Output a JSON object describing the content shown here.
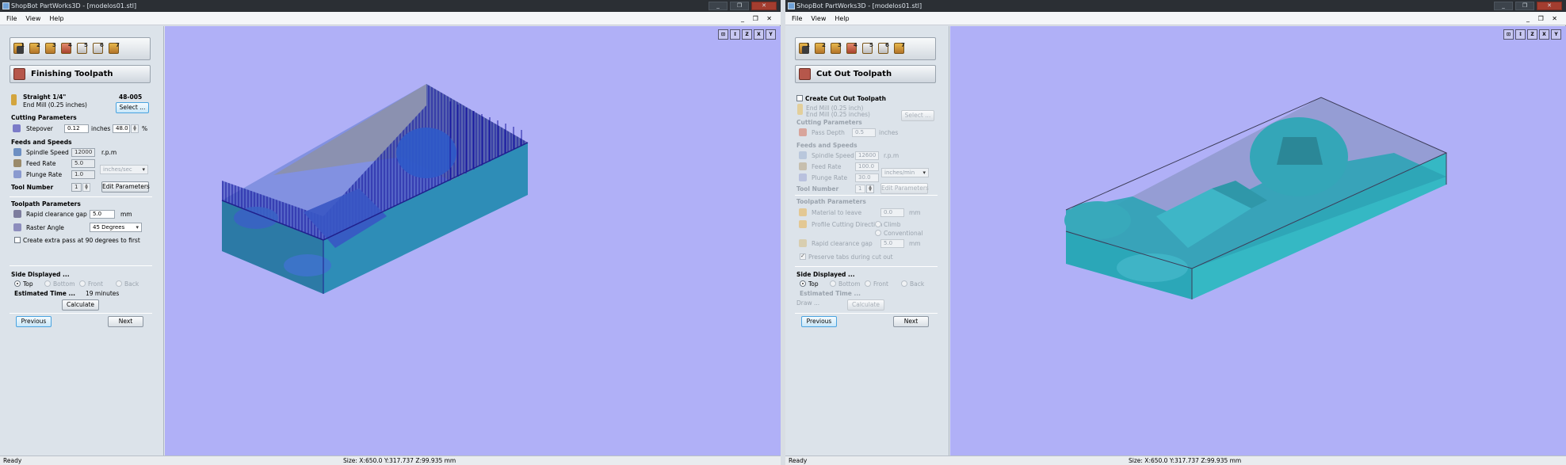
{
  "left": {
    "title": "ShopBot PartWorks3D - [modelos01.stl]",
    "window_controls": [
      "_",
      "❐",
      "✕"
    ],
    "menu": [
      "File",
      "View",
      "Help"
    ],
    "mdi_controls": "_ ❐ ✕",
    "toolbar": [
      "1",
      "2",
      "3",
      "4",
      "5",
      "6",
      "7"
    ],
    "page_title": "Finishing Toolpath",
    "tool_name": "Straight 1/4\"",
    "tool_desc": "End Mill (0.25 inches)",
    "tool_code": "48-005",
    "select_button": "Select ...",
    "cutting_header": "Cutting Parameters",
    "stepover_label": "Stepover",
    "stepover_value": "0.12",
    "stepover_unit": "inches",
    "stepover_pct": "48.0",
    "pct_sign": "%",
    "feeds_header": "Feeds and Speeds",
    "spindle_label": "Spindle Speed",
    "spindle_value": "12000",
    "spindle_unit": "r.p.m",
    "feed_label": "Feed Rate",
    "feed_value": "5.0",
    "rate_units": "inches/sec",
    "plunge_label": "Plunge Rate",
    "plunge_value": "1.0",
    "toolnum_label": "Tool Number",
    "toolnum_value": "1",
    "edit_params": "Edit Parameters",
    "toolpath_header": "Toolpath Parameters",
    "rapid_label": "Rapid clearance gap",
    "rapid_value": "5.0",
    "rapid_unit": "mm",
    "raster_label": "Raster Angle",
    "raster_value": "45 Degrees",
    "extra_pass_label": "Create extra pass at 90 degrees to first",
    "side_header": "Side Displayed ...",
    "side_options": [
      "Top",
      "Bottom",
      "Front",
      "Back"
    ],
    "est_label": "Estimated Time ...",
    "est_value": "19 minutes",
    "calculate": "Calculate",
    "previous": "Previous",
    "next": "Next",
    "view_tools": [
      "⊡",
      "↕",
      "Z",
      "X",
      "Y"
    ],
    "status_left": "Ready",
    "status_center": "Size: X:650.0 Y:317.737 Z:99.935 mm"
  },
  "right": {
    "title": "ShopBot PartWorks3D - [modelos01.stl]",
    "window_controls": [
      "_",
      "❐",
      "✕"
    ],
    "menu": [
      "File",
      "View",
      "Help"
    ],
    "mdi_controls": "_ ❐ ✕",
    "toolbar": [
      "1",
      "2",
      "3",
      "4",
      "5",
      "6",
      "7"
    ],
    "page_title": "Cut Out Toolpath",
    "create_label": "Create Cut Out Toolpath",
    "tool_desc": "End Mill (0.25 inch)",
    "tool_desc2": "End Mill (0.25 inches)",
    "select_button": "Select ...",
    "cutting_header": "Cutting Parameters",
    "pass_depth_label": "Pass Depth",
    "pass_depth_value": "0.5",
    "pass_depth_unit": "inches",
    "feeds_header": "Feeds and Speeds",
    "spindle_label": "Spindle Speed",
    "spindle_value": "12600",
    "spindle_unit": "r.p.m",
    "feed_label": "Feed Rate",
    "feed_value": "100.0",
    "rate_units": "inches/min",
    "plunge_label": "Plunge Rate",
    "plunge_value": "30.0",
    "toolnum_label": "Tool Number",
    "toolnum_value": "1",
    "edit_params": "Edit Parameters",
    "toolpath_header": "Toolpath Parameters",
    "material_label": "Material to leave",
    "material_value": "0.0",
    "material_unit": "mm",
    "direction_label": "Profile Cutting Direction",
    "direction_options": [
      "Climb",
      "Conventional"
    ],
    "rapid_label": "Rapid clearance gap",
    "rapid_value": "5.0",
    "rapid_unit": "mm",
    "tabs_label": "Preserve tabs during cut out",
    "side_header": "Side Displayed ...",
    "side_options": [
      "Top",
      "Bottom",
      "Front",
      "Back"
    ],
    "est_label": "Estimated Time ...",
    "draw_label": "Draw ...",
    "calculate": "Calculate",
    "previous": "Previous",
    "next": "Next",
    "view_tools": [
      "⊡",
      "↕",
      "Z",
      "X",
      "Y"
    ],
    "status_left": "Ready",
    "status_center": "Size: X:650.0 Y:317.737 Z:99.935 mm"
  }
}
